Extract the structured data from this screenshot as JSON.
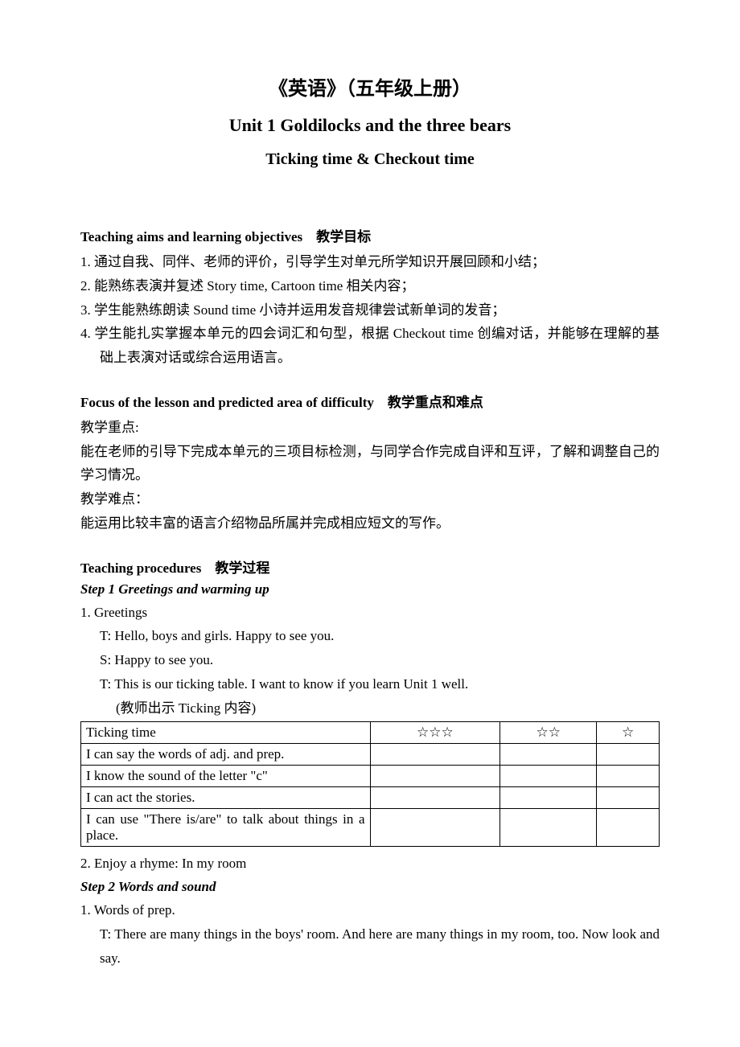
{
  "titles": {
    "main": "《英语》（五年级上册）",
    "sub1": "Unit 1 Goldilocks and the three bears",
    "sub2": "Ticking time & Checkout time"
  },
  "aims": {
    "head": "Teaching aims and learning objectives　教学目标",
    "items": [
      "1. 通过自我、同伴、老师的评价，引导学生对单元所学知识开展回顾和小结；",
      "2. 能熟练表演并复述 Story time, Cartoon time 相关内容；",
      "3. 学生能熟练朗读 Sound time 小诗并运用发音规律尝试新单词的发音；",
      "4. 学生能扎实掌握本单元的四会词汇和句型，根据 Checkout time 创编对话，并能够在理解的基础上表演对话或综合运用语言。"
    ]
  },
  "focus": {
    "head": "Focus of the lesson and predicted area of difficulty　教学重点和难点",
    "keyLabel": "教学重点:",
    "keyText": "能在老师的引导下完成本单元的三项目标检测，与同学合作完成自评和互评，了解和调整自己的学习情况。",
    "diffLabel": "教学难点：",
    "diffText": "能运用比较丰富的语言介绍物品所属并完成相应短文的写作。"
  },
  "procedures": {
    "head": "Teaching procedures　教学过程",
    "step1": {
      "title": "Step 1 Greetings and warming up",
      "greetLabel": "1. Greetings",
      "lines": {
        "l1": "T: Hello, boys and girls. Happy to see you.",
        "l2": "S: Happy to see you.",
        "l3": "T: This is our ticking table. I want to know if you learn Unit 1 well.",
        "l4": "(教师出示 Ticking 内容)"
      },
      "enjoy": "2. Enjoy a rhyme: In my room"
    },
    "table": {
      "header": {
        "c1": "Ticking time",
        "c2": "☆☆☆",
        "c3": "☆☆",
        "c4": "☆"
      },
      "rows": [
        {
          "c1": "I can say the words of adj. and prep.",
          "c2": "",
          "c3": "",
          "c4": ""
        },
        {
          "c1": "I know the sound of the letter \"c\"",
          "c2": "",
          "c3": "",
          "c4": ""
        },
        {
          "c1": "I can act the stories.",
          "c2": "",
          "c3": "",
          "c4": ""
        },
        {
          "c1": "I can use \"There is/are\" to talk about things in a place.",
          "c2": "",
          "c3": "",
          "c4": ""
        }
      ]
    },
    "step2": {
      "title": "Step 2 Words and sound",
      "item1": "1. Words of prep.",
      "line": "T: There are many things in the boys' room. And here are many things in my room, too. Now look and say."
    }
  }
}
